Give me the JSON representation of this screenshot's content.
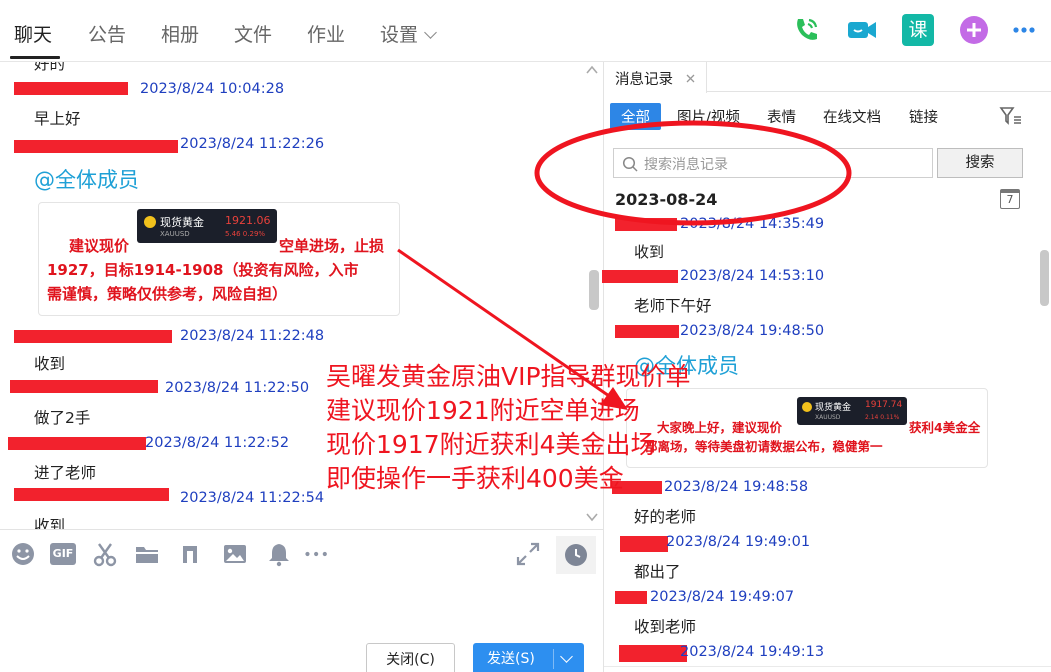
{
  "top_tabs": [
    "聊天",
    "公告",
    "相册",
    "文件",
    "作业",
    "设置"
  ],
  "colors": {
    "accent": "#2d86e6",
    "stamp": "#1f3fbf",
    "redact": "#f2222d",
    "mention": "#1ea0d6",
    "annotation": "#ef1520",
    "call_green": "#2bbf5a",
    "video_teal": "#1aa8d0",
    "course_teal": "#13b8a6",
    "add_purple": "#c36be6"
  },
  "top_icons": [
    "phone-icon",
    "video-icon",
    "course-icon",
    "add-app-icon",
    "more-icon"
  ],
  "top_icon_course_label": "课",
  "chat": {
    "messages": [
      {
        "text": "好的"
      },
      {
        "stamp": "2023/8/24 10:04:28",
        "text": "早上好"
      },
      {
        "stamp": "2023/8/24 11:22:26",
        "mention": "@全体成员"
      },
      {
        "stamp": "2023/8/24 11:22:48",
        "text": "收到"
      },
      {
        "stamp": "2023/8/24 11:22:50",
        "text": "做了2手"
      },
      {
        "stamp": "2023/8/24 11:22:52",
        "text": "进了老师"
      },
      {
        "stamp": "2023/8/24 11:22:54",
        "text": "收到"
      }
    ],
    "image_card": {
      "ticker_name": "现货黄金",
      "ticker_code": "XAUUSD",
      "ticker_price": "1921.06",
      "ticker_change": "5.46  0.29%",
      "lead": "建议现价",
      "line1_tail": "空单进场，止损",
      "line2": "1927，目标1914-1908（投资有风险，入市",
      "line3": "需谨慎，策略仅供参考，风险自担）"
    }
  },
  "annotation": {
    "lines": [
      "吴曜发黄金原油VIP指导群现价单",
      "建议现价1921附近空单进场",
      "现价1917附近获利4美金出场",
      "即使操作一手获利400美金"
    ]
  },
  "toolbar": {
    "icons": [
      "emoji-icon",
      "gif-icon",
      "scissors-icon",
      "folder-icon",
      "music-icon",
      "image-icon",
      "bell-icon",
      "more-dots-icon",
      "expand-icon",
      "clock-icon"
    ],
    "gif_label": "GIF"
  },
  "buttons": {
    "close": "关闭(C)",
    "send": "发送(S)"
  },
  "history": {
    "tab_title": "消息记录",
    "filters": [
      "全部",
      "图片/视频",
      "表情",
      "在线文档",
      "链接"
    ],
    "search_placeholder": "搜索消息记录",
    "search_button": "搜索",
    "date": "2023-08-24",
    "calendar_day": "7",
    "entries": [
      {
        "stamp": "2023/8/24 14:35:49",
        "text": "收到"
      },
      {
        "stamp": "2023/8/24 14:53:10",
        "text": "老师下午好"
      },
      {
        "stamp": "2023/8/24 19:48:50",
        "mention": "@全体成员"
      },
      {
        "stamp": "2023/8/24 19:48:58",
        "text": "好的老师"
      },
      {
        "stamp": "2023/8/24 19:49:01",
        "text": "都出了"
      },
      {
        "stamp": "2023/8/24 19:49:07",
        "text": "收到老师"
      },
      {
        "stamp": "2023/8/24 19:49:13"
      }
    ],
    "image_card": {
      "ticker_name": "现货黄金",
      "ticker_code": "XAUUSD",
      "ticker_price": "1917.74",
      "ticker_change": "2.14  0.11%",
      "lead": "大家晚上好，建议现价",
      "line1_tail": "获利4美金全",
      "line2": "部离场，等待美盘初请数据公布，稳健第一"
    }
  }
}
